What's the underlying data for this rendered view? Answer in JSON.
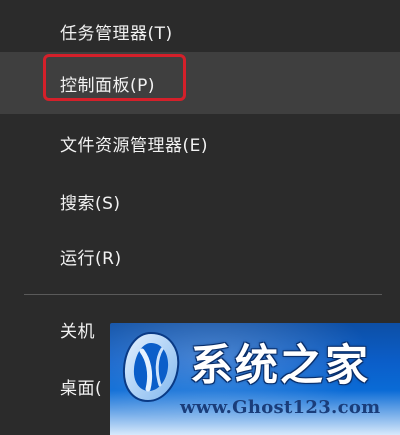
{
  "menu": {
    "items": [
      {
        "label": "任务管理器(T)"
      },
      {
        "label": "控制面板(P)"
      },
      {
        "label": "文件资源管理器(E)"
      },
      {
        "label": "搜索(S)"
      },
      {
        "label": "运行(R)"
      },
      {
        "label": "关机"
      },
      {
        "label": "桌面("
      }
    ]
  },
  "watermark": {
    "title": "系统之家",
    "url": "www.Ghost123.com"
  },
  "colors": {
    "menu_background": "#2b2b2b",
    "hover_background": "#3f3f3f",
    "highlight_border": "#d4202a",
    "text": "#f2f2f2"
  }
}
